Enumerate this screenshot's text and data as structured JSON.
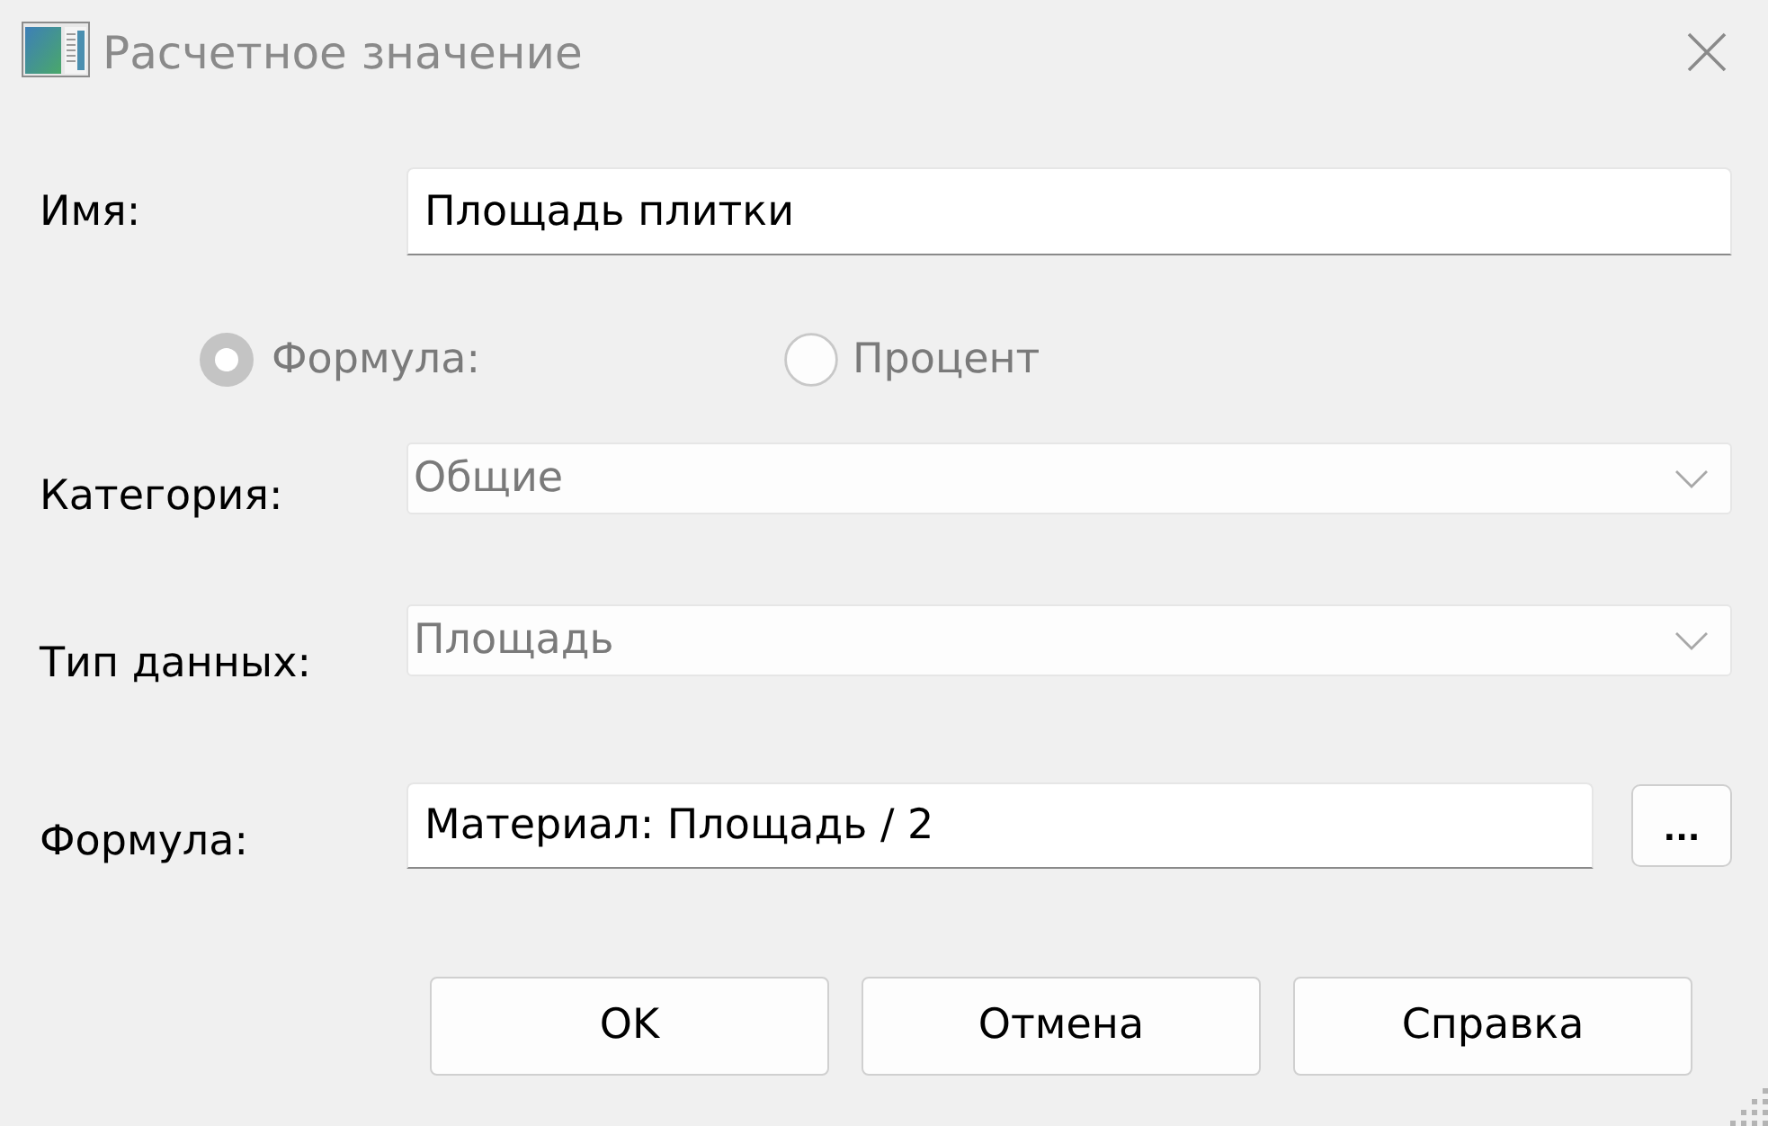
{
  "window": {
    "title": "Расчетное значение"
  },
  "name_field": {
    "label": "Имя:",
    "value": "Площадь плитки"
  },
  "value_type": [
    {
      "label": "Формула:",
      "selected": true,
      "disabled": true
    },
    {
      "label": "Процент",
      "selected": false,
      "disabled": true
    }
  ],
  "category": {
    "label": "Категория:",
    "value": "Общие",
    "disabled": true
  },
  "data_type": {
    "label": "Тип данных:",
    "value": "Площадь",
    "disabled": true
  },
  "formula": {
    "label": "Формула:",
    "value": "Материал: Площадь / 2",
    "button": "..."
  },
  "buttons": [
    "OK",
    "Отмена",
    "Справка"
  ]
}
